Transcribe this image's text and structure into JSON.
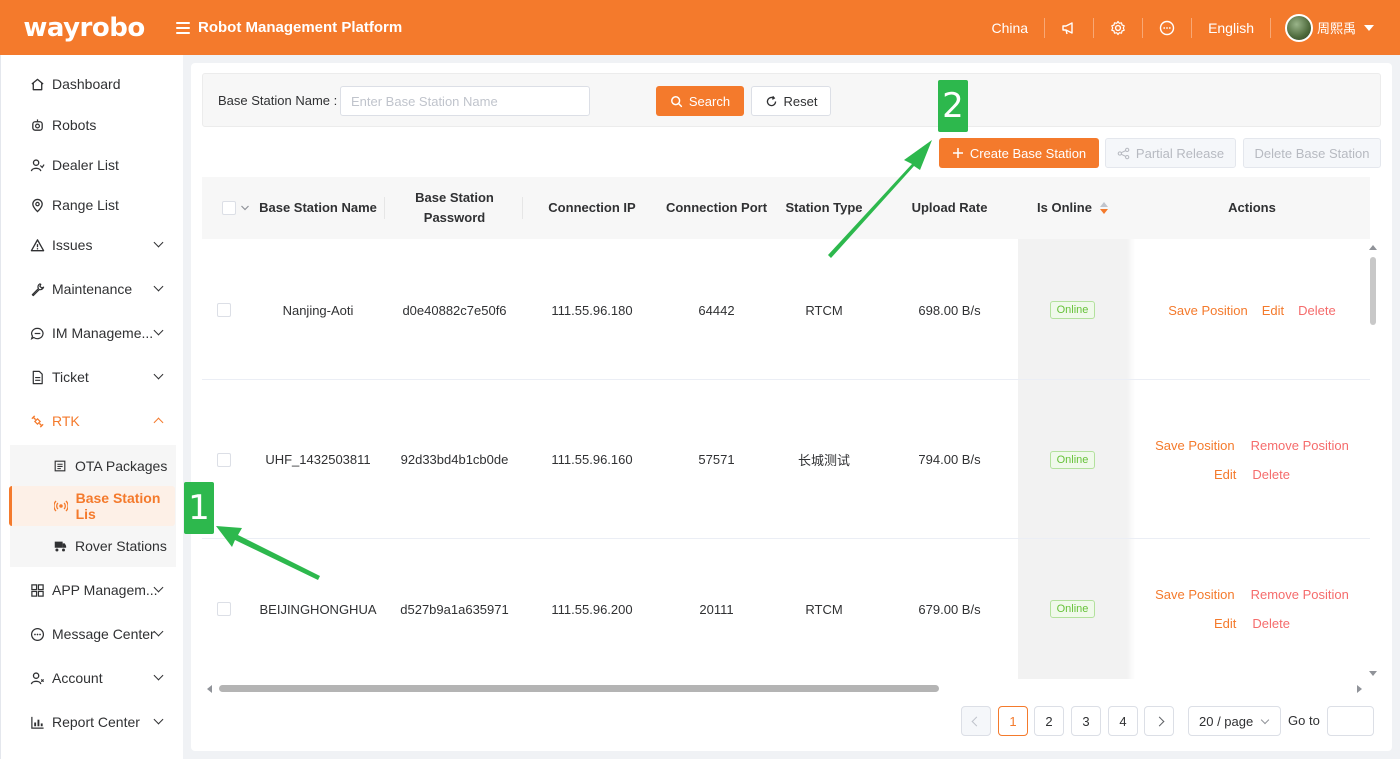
{
  "header": {
    "logo": "wayrobo",
    "title": "Robot Management Platform",
    "region": "China",
    "language": "English",
    "user": "周熙禹"
  },
  "sidebar": {
    "items": [
      {
        "label": "Dashboard",
        "icon": "home-icon"
      },
      {
        "label": "Robots",
        "icon": "robot-icon"
      },
      {
        "label": "Dealer List",
        "icon": "dealer-icon"
      },
      {
        "label": "Range List",
        "icon": "location-pin-icon"
      },
      {
        "label": "Issues",
        "icon": "warning-icon"
      },
      {
        "label": "Maintenance",
        "icon": "wrench-icon"
      },
      {
        "label": "IM Manageme...",
        "icon": "chat-icon"
      },
      {
        "label": "Ticket",
        "icon": "document-icon"
      },
      {
        "label": "RTK",
        "icon": "satellite-icon"
      },
      {
        "label": "APP Managem...",
        "icon": "grid-icon"
      },
      {
        "label": "Message Center",
        "icon": "message-icon"
      },
      {
        "label": "Account",
        "icon": "account-icon"
      },
      {
        "label": "Report Center",
        "icon": "bar-chart-icon"
      }
    ],
    "rtk_children": [
      {
        "label": "OTA Packages",
        "icon": "package-icon"
      },
      {
        "label": "Base Station Lis",
        "icon": "base-station-icon"
      },
      {
        "label": "Rover Stations",
        "icon": "rover-icon"
      }
    ]
  },
  "search": {
    "label": "Base Station Name :",
    "placeholder": "Enter Base Station Name",
    "search_label": "Search",
    "reset_label": "Reset"
  },
  "toolbar": {
    "create_label": "Create Base Station",
    "release_label": "Partial Release",
    "delete_label": "Delete Base Station"
  },
  "table": {
    "columns": [
      "Base Station Name",
      "Base Station Password",
      "Connection IP",
      "Connection Port",
      "Station Type",
      "Upload Rate",
      "Is Online",
      "Actions"
    ],
    "rows": [
      {
        "name": "Nanjing-Aoti",
        "password": "d0e40882c7e50f6",
        "ip": "111.55.96.180",
        "port": "64442",
        "type": "RTCM",
        "rate": "698.00 B/s",
        "online": "Online",
        "actions": [
          "Save Position",
          "Edit",
          "Delete"
        ]
      },
      {
        "name": "UHF_1432503811",
        "password": "92d33bd4b1cb0de",
        "ip": "111.55.96.160",
        "port": "57571",
        "type": "长城测试",
        "rate": "794.00 B/s",
        "online": "Online",
        "actions": [
          "Save Position",
          "Remove Position",
          "Edit",
          "Delete"
        ]
      },
      {
        "name": "BEIJINGHONGHUA",
        "password": "d527b9a1a635971",
        "ip": "111.55.96.200",
        "port": "20111",
        "type": "RTCM",
        "rate": "679.00 B/s",
        "online": "Online",
        "actions": [
          "Save Position",
          "Remove Position",
          "Edit",
          "Delete"
        ]
      }
    ]
  },
  "pagination": {
    "pages": [
      "1",
      "2",
      "3",
      "4"
    ],
    "current": "1",
    "page_size": "20 / page",
    "goto_label": "Go to"
  },
  "annotations": {
    "marker_1": "1",
    "marker_2": "2",
    "color": "#2db84d"
  },
  "colors": {
    "brand": "#f47a2c",
    "danger": "#f56c6c",
    "success": "#67c23a"
  }
}
